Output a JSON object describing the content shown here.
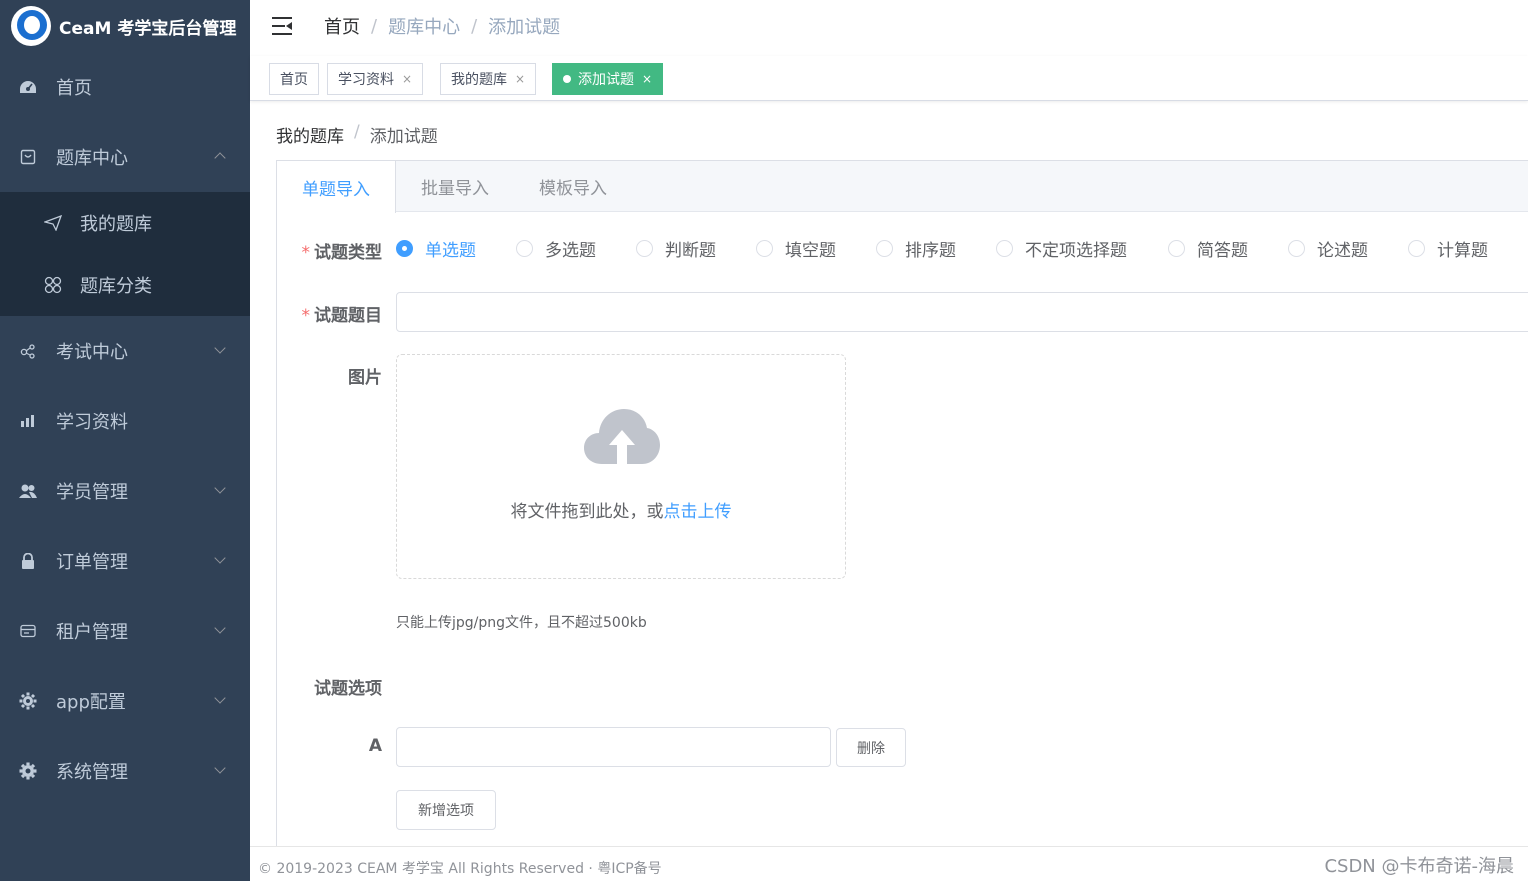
{
  "app": {
    "title": "CeaM 考学宝后台管理"
  },
  "sidebar": {
    "items": [
      {
        "label": "首页",
        "icon": "dashboard-icon"
      },
      {
        "label": "题库中心",
        "icon": "box-icon",
        "expanded": true,
        "children": [
          {
            "label": "我的题库",
            "icon": "send-icon"
          },
          {
            "label": "题库分类",
            "icon": "grid-icon"
          }
        ]
      },
      {
        "label": "考试中心",
        "icon": "share-icon"
      },
      {
        "label": "学习资料",
        "icon": "chart-icon"
      },
      {
        "label": "学员管理",
        "icon": "users-icon"
      },
      {
        "label": "订单管理",
        "icon": "lock-icon"
      },
      {
        "label": "租户管理",
        "icon": "card-icon"
      },
      {
        "label": "app配置",
        "icon": "gear-icon"
      },
      {
        "label": "系统管理",
        "icon": "settings-icon"
      }
    ]
  },
  "navbar": {
    "breadcrumb": [
      "首页",
      "题库中心",
      "添加试题"
    ]
  },
  "tags": [
    {
      "label": "首页",
      "closable": false
    },
    {
      "label": "学习资料",
      "closable": true
    },
    {
      "label": "我的题库",
      "closable": true
    },
    {
      "label": "添加试题",
      "closable": true,
      "active": true
    }
  ],
  "page": {
    "crumb": [
      "我的题库",
      "添加试题"
    ],
    "tabs": [
      "单题导入",
      "批量导入",
      "模板导入"
    ],
    "form": {
      "type_label": "试题类型",
      "types": [
        "单选题",
        "多选题",
        "判断题",
        "填空题",
        "排序题",
        "不定项选择题",
        "简答题",
        "论述题",
        "计算题"
      ],
      "selected_type": "单选题",
      "title_label": "试题题目",
      "title_value": "",
      "image_label": "图片",
      "upload_text": "将文件拖到此处，或",
      "upload_link": "点击上传",
      "upload_tip": "只能上传jpg/png文件，且不超过500kb",
      "options_label": "试题选项",
      "option_letter": "A",
      "option_value": "",
      "delete_btn": "删除",
      "add_option_btn": "新增选项"
    }
  },
  "footer": {
    "copyright": "© 2019-2023 CEAM 考学宝 All Rights Reserved · 粤ICP备号",
    "watermark": "CSDN @卡布奇诺-海晨"
  },
  "colors": {
    "sidebar_bg": "#304156",
    "accent": "#409eff",
    "tag_active": "#42b983",
    "required": "#f56c6c"
  }
}
